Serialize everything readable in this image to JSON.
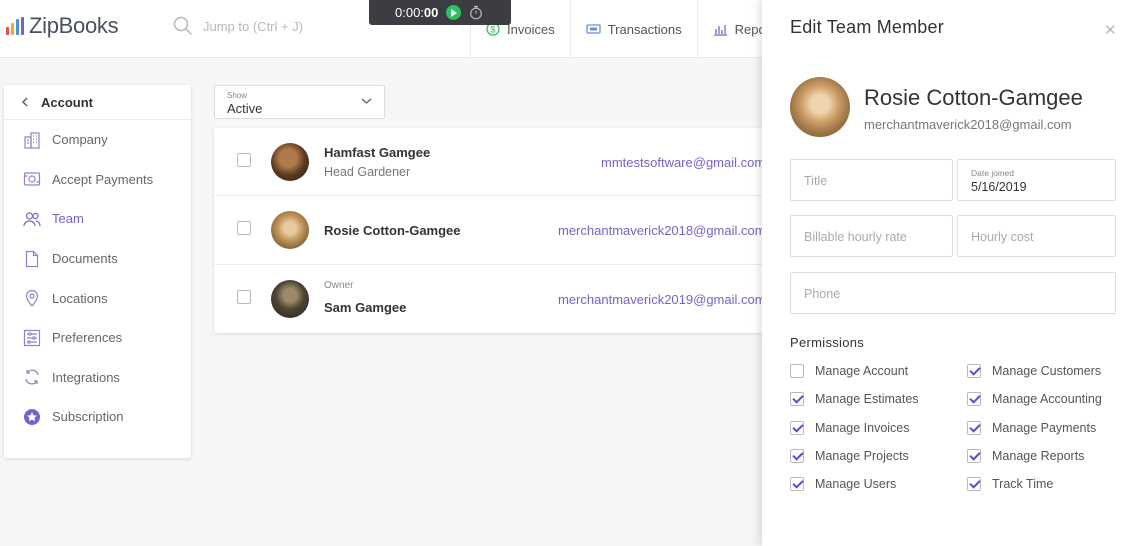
{
  "app": {
    "name": "ZipBooks",
    "brand_color": "#7a5fcf"
  },
  "search": {
    "placeholder": "Jump to (Ctrl + J)"
  },
  "timer": {
    "value_prefix": "0:00:",
    "value_bold": "00"
  },
  "topnav": [
    {
      "label": "Invoices",
      "icon": "dollar-circle-icon"
    },
    {
      "label": "Transactions",
      "icon": "bank-card-icon"
    },
    {
      "label": "Repo",
      "icon": "chart-icon"
    }
  ],
  "sidebar": {
    "title": "Account",
    "items": [
      {
        "label": "Company",
        "icon": "building-icon"
      },
      {
        "label": "Accept Payments",
        "icon": "payments-icon"
      },
      {
        "label": "Team",
        "icon": "team-icon",
        "active": true
      },
      {
        "label": "Documents",
        "icon": "document-icon"
      },
      {
        "label": "Locations",
        "icon": "location-pin-icon"
      },
      {
        "label": "Preferences",
        "icon": "preferences-icon"
      },
      {
        "label": "Integrations",
        "icon": "integrations-icon"
      },
      {
        "label": "Subscription",
        "icon": "star-badge-icon"
      }
    ]
  },
  "filter": {
    "label": "Show",
    "value": "Active"
  },
  "team": [
    {
      "role_top": "",
      "name": "Hamfast Gamgee",
      "role": "Head Gardener",
      "email": "mmtestsoftware@gmail.com"
    },
    {
      "role_top": "",
      "name": "Rosie Cotton-Gamgee",
      "role": "",
      "email": "merchantmaverick2018@gmail.com"
    },
    {
      "role_top": "Owner",
      "name": "Sam Gamgee",
      "role": "",
      "email": "merchantmaverick2019@gmail.com"
    }
  ],
  "panel": {
    "title": "Edit Team Member",
    "member_name": "Rosie Cotton-Gamgee",
    "member_email": "merchantmaverick2018@gmail.com",
    "fields": {
      "title_placeholder": "Title",
      "date_joined_label": "Date joined",
      "date_joined_value": "5/16/2019",
      "billable_rate_placeholder": "Billable hourly rate",
      "hourly_cost_placeholder": "Hourly cost",
      "phone_placeholder": "Phone"
    },
    "permissions_title": "Permissions",
    "permissions": [
      {
        "label": "Manage Account",
        "checked": false
      },
      {
        "label": "Manage Customers",
        "checked": true
      },
      {
        "label": "Manage Estimates",
        "checked": true
      },
      {
        "label": "Manage Accounting",
        "checked": true
      },
      {
        "label": "Manage Invoices",
        "checked": true
      },
      {
        "label": "Manage Payments",
        "checked": true
      },
      {
        "label": "Manage Projects",
        "checked": true
      },
      {
        "label": "Manage Reports",
        "checked": true
      },
      {
        "label": "Manage Users",
        "checked": true
      },
      {
        "label": "Track Time",
        "checked": true
      }
    ]
  }
}
